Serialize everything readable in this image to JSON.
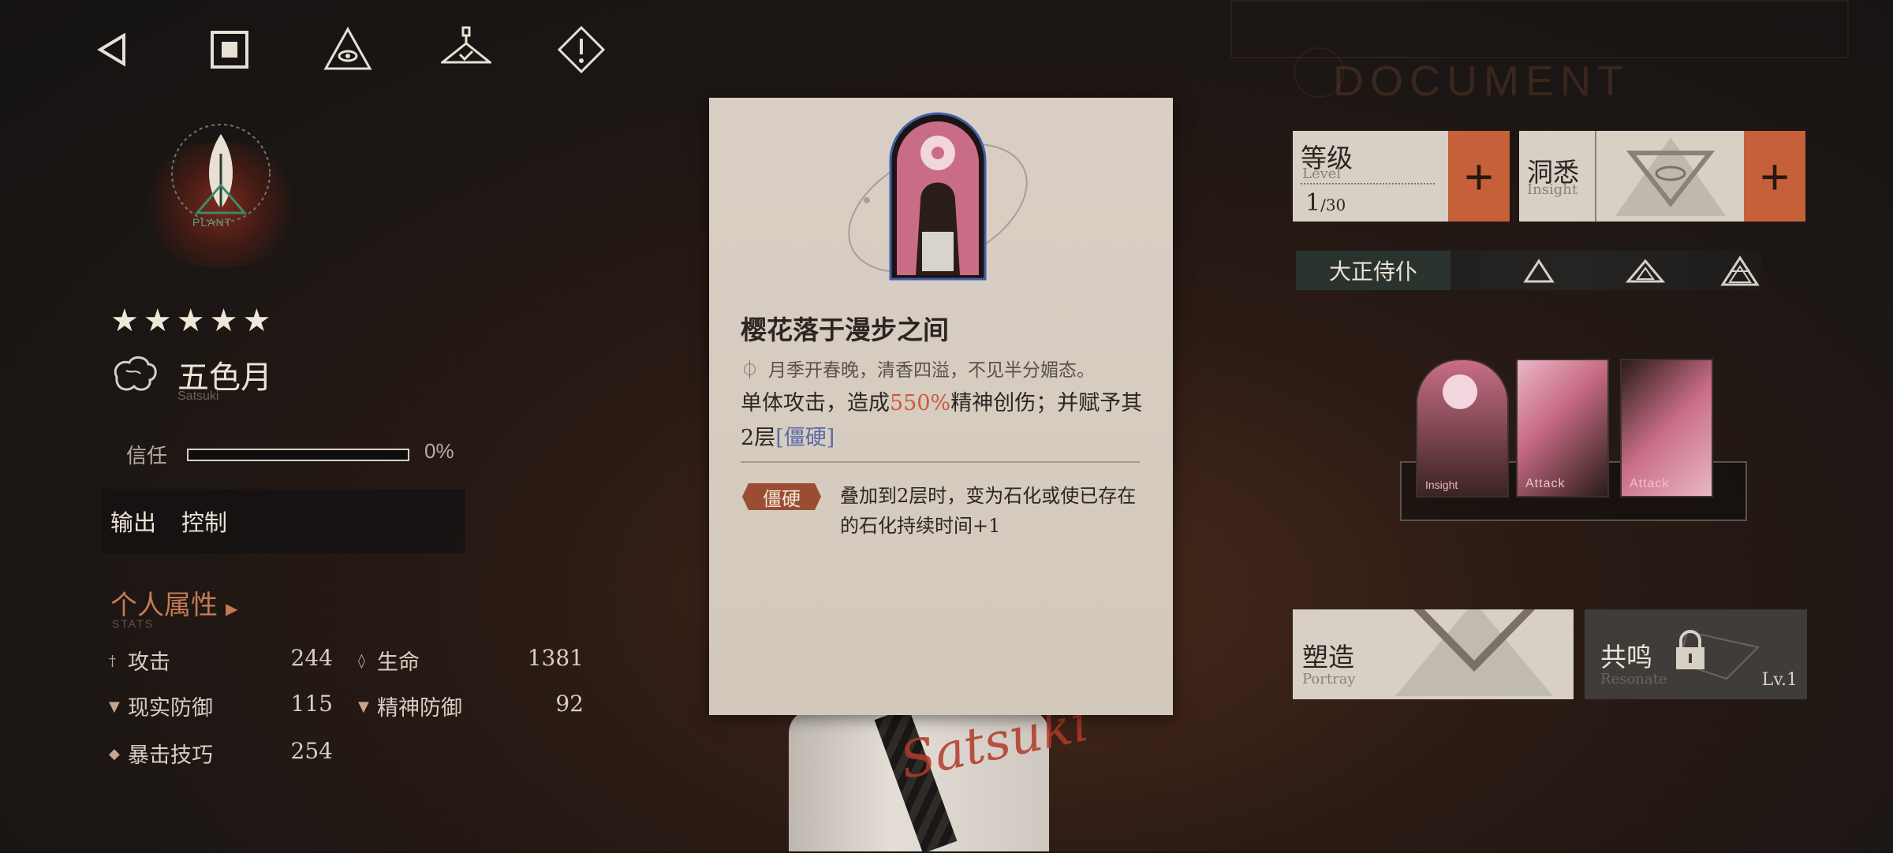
{
  "nav": {
    "back_icon": "back-triangle-icon",
    "home_icon": "stop-square-icon",
    "eye_icon": "eye-triangle-icon",
    "hanger_icon": "hanger-icon",
    "warning_icon": "warning-diamond-icon"
  },
  "background": {
    "watermark_text": "DOCUMENT"
  },
  "character": {
    "afflatus_label": "PLANT",
    "stars": "★★★★★",
    "name": "五色月",
    "name_en": "Satsuki",
    "trust_label": "信任",
    "trust_value": "0%",
    "trust_fraction": 0.0,
    "tags": [
      "输出",
      "控制"
    ]
  },
  "stats": {
    "title": "个人属性",
    "subtitle": "STATS",
    "items": [
      {
        "label": "攻击",
        "value": "244"
      },
      {
        "label": "生命",
        "value": "1381"
      },
      {
        "label": "现实防御",
        "value": "115"
      },
      {
        "label": "精神防御",
        "value": "92"
      },
      {
        "label": "暴击技巧",
        "value": "254"
      }
    ]
  },
  "card": {
    "title": "樱花落于漫步之间",
    "flavor": "月季开春晚，清香四溢，不见半分媚态。",
    "desc_pre": "单体攻击，造成",
    "desc_pct": "550%",
    "desc_mid": "精神创伤；并赋予其2层",
    "desc_kw": "[僵硬]",
    "status_name": "僵硬",
    "status_desc": "叠加到2层时，变为石化或使已存在的石化持续时间+1"
  },
  "level": {
    "label": "等级",
    "label_en": "Level",
    "current": "1",
    "max": "/30",
    "plus": "+"
  },
  "insight": {
    "label": "洞悉",
    "label_en": "Insight",
    "plus": "+"
  },
  "rank": {
    "label": "大正侍仆"
  },
  "cards_tray": {
    "labels": [
      "Insight",
      "Attack",
      "Attack"
    ]
  },
  "portray": {
    "label": "塑造",
    "label_en": "Portray"
  },
  "resonate": {
    "label": "共鸣",
    "label_en": "Resonate",
    "level": "Lv.1"
  },
  "signature": "Satsuki",
  "colors": {
    "accent_orange": "#c5603a",
    "card_bg": "#d8cfc4",
    "highlight_red": "#d0583c",
    "keyword_blue": "#5c6ca8"
  }
}
